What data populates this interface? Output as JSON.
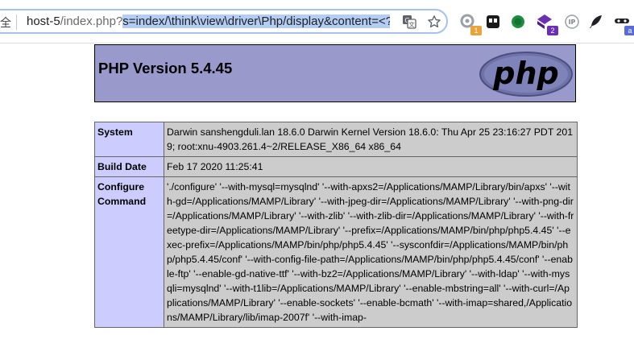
{
  "browser": {
    "secure_label": "全",
    "url_host": "host-5",
    "url_path": "/index.php",
    "url_query_mark": "?",
    "url_selected_query": "s=index/\\think\\view\\driver\\Php/display&content=<?p",
    "badges": {
      "ext1": "1",
      "ext4": "2",
      "ext8": "a"
    },
    "colors": {
      "omnibox_border": "#a7c1ef",
      "selection": "#b4cdf4"
    }
  },
  "php": {
    "title": "PHP Version 5.4.45",
    "logo_text": "php",
    "colors": {
      "header_bg": "#9999cc",
      "label_bg": "#ccccff",
      "value_bg": "#cccccc"
    },
    "rows": [
      {
        "label": "System",
        "value": "Darwin sanshengduli.lan 18.6.0 Darwin Kernel Version 18.6.0: Thu Apr 25 23:16:27 PDT 2019; root:xnu-4903.261.4~2/RELEASE_X86_64 x86_64"
      },
      {
        "label": "Build Date",
        "value": "Feb 17 2020 11:25:41"
      },
      {
        "label": "Configure Command",
        "value": "'./configure' '--with-mysql=mysqlnd' '--with-apxs2=/Applications/MAMP/Library/bin/apxs' '--with-gd=/Applications/MAMP/Library' '--with-jpeg-dir=/Applications/MAMP/Library' '--with-png-dir=/Applications/MAMP/Library' '--with-zlib' '--with-zlib-dir=/Applications/MAMP/Library' '--with-freetype-dir=/Applications/MAMP/Library' '--prefix=/Applications/MAMP/bin/php/php5.4.45' '--exec-prefix=/Applications/MAMP/bin/php/php5.4.45' '--sysconfdir=/Applications/MAMP/bin/php/php5.4.45/conf' '--with-config-file-path=/Applications/MAMP/bin/php/php5.4.45/conf' '--enable-ftp' '--enable-gd-native-ttf' '--with-bz2=/Applications/MAMP/Library' '--with-ldap' '--with-mysqli=mysqlnd' '--with-t1lib=/Applications/MAMP/Library' '--enable-mbstring=all' '--with-curl=/Applications/MAMP/Library' '--enable-sockets' '--enable-bcmath' '--with-imap=shared,/Applications/MAMP/Library/lib/imap-2007f' '--with-imap-"
      }
    ]
  }
}
